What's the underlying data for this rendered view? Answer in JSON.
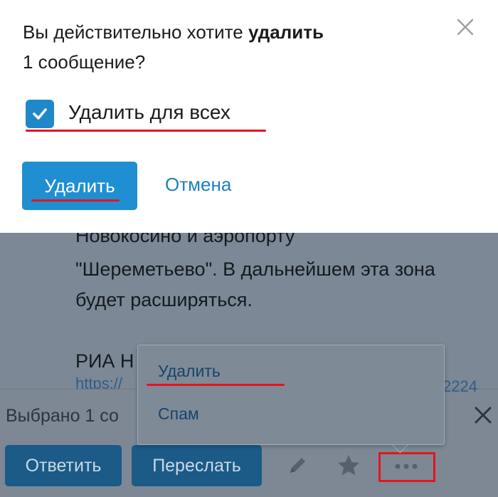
{
  "background_message": {
    "lines": [
      "Новокосино и аэропорту",
      "\"Шереметьево\". В дальнейшем эта зона",
      "будет расширяться.",
      "РИА Н"
    ],
    "link_fragment": "https://",
    "link_fragment_end": "2224"
  },
  "selection_bar": {
    "title": "Выбрано 1 со",
    "reply_label": "Ответить",
    "forward_label": "Переслать",
    "icons": [
      "close-icon",
      "pencil-icon",
      "star-icon",
      "more-icon"
    ]
  },
  "popup_menu": {
    "items": [
      {
        "label": "Удалить"
      },
      {
        "label": "Спам"
      }
    ]
  },
  "dialog": {
    "title_prefix": "Вы действительно хотите ",
    "title_bold": "удалить",
    "title_suffix": "1 сообщение?",
    "checkbox_label": "Удалить для всех",
    "checkbox_checked": true,
    "delete_label": "Удалить",
    "cancel_label": "Отмена"
  },
  "colors": {
    "accent": "#1f8fd2",
    "dark_button": "#1c5a87",
    "highlight": "#e5141c"
  }
}
